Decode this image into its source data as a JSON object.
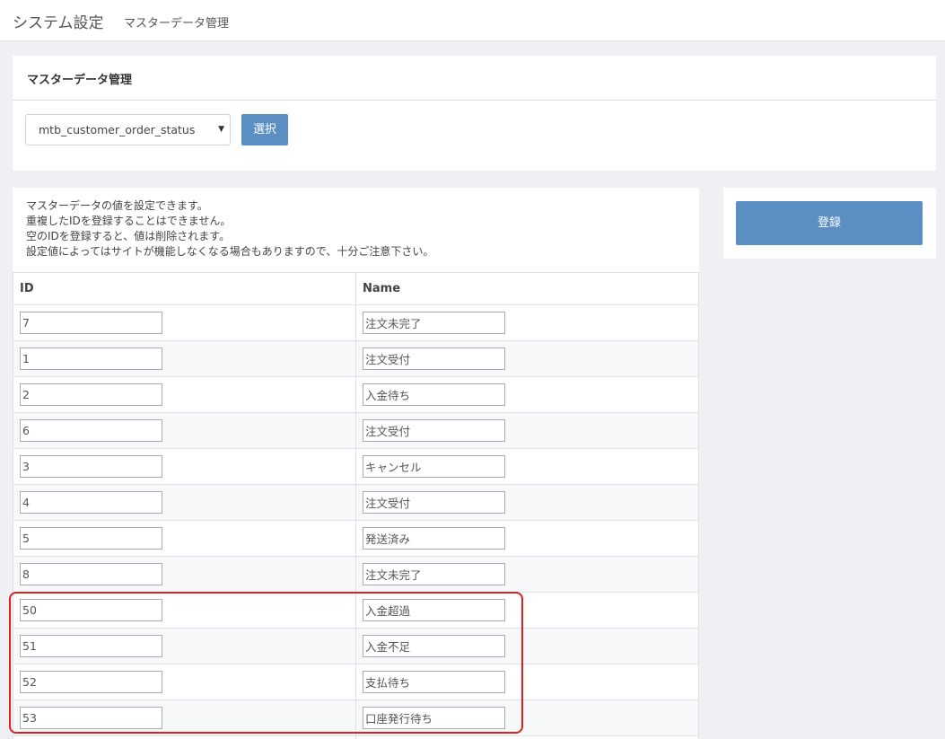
{
  "header": {
    "title": "システム設定",
    "subtitle": "マスターデータ管理"
  },
  "master_panel": {
    "heading": "マスターデータ管理",
    "select_value": "mtb_customer_order_status",
    "select_button": "選択"
  },
  "description": [
    "マスターデータの値を設定できます。",
    "重複したIDを登録することはできません。",
    "空のIDを登録すると、値は削除されます。",
    "設定値によってはサイトが機能しなくなる場合もありますので、十分ご注意下さい。"
  ],
  "table": {
    "headers": {
      "id": "ID",
      "name": "Name"
    },
    "rows": [
      {
        "id": "7",
        "name": "注文未完了"
      },
      {
        "id": "1",
        "name": "注文受付"
      },
      {
        "id": "2",
        "name": "入金待ち"
      },
      {
        "id": "6",
        "name": "注文受付"
      },
      {
        "id": "3",
        "name": "キャンセル"
      },
      {
        "id": "4",
        "name": "注文受付"
      },
      {
        "id": "5",
        "name": "発送済み"
      },
      {
        "id": "8",
        "name": "注文未完了"
      },
      {
        "id": "50",
        "name": "入金超過"
      },
      {
        "id": "51",
        "name": "入金不足"
      },
      {
        "id": "52",
        "name": "支払待ち"
      },
      {
        "id": "53",
        "name": "口座発行待ち"
      },
      {
        "id": "",
        "name": ""
      }
    ]
  },
  "side_panel": {
    "register_button": "登録"
  },
  "colors": {
    "accent": "#5b8ec3",
    "highlight": "#e02020"
  }
}
